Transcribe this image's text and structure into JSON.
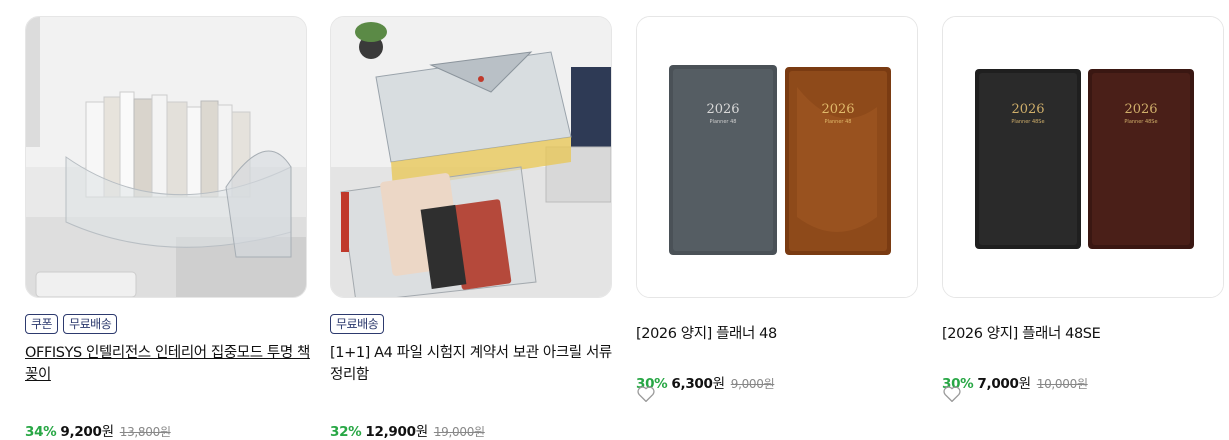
{
  "products": [
    {
      "image_alt": "acrylic bookshelf with books",
      "badges": [
        "쿠폰",
        "무료배송"
      ],
      "title": "OFFISYS 인텔리전스 인테리어 집중모드 투명 책꽂이",
      "discount": "34%",
      "price": "9,200",
      "currency": "원",
      "original_price": "13,800원"
    },
    {
      "image_alt": "acrylic A4 file storage box",
      "badges": [
        "무료배송"
      ],
      "title": "[1+1] A4 파일 시험지 계약서 보관 아크릴 서류 정리함",
      "discount": "32%",
      "price": "12,900",
      "currency": "원",
      "original_price": "19,000원"
    },
    {
      "image_alt": "2026 planner 48 black and brown",
      "badges": [],
      "title": "[2026 양지] 플래너 48",
      "discount": "30%",
      "price": "6,300",
      "currency": "원",
      "original_price": "9,000원",
      "cover_year": "2026",
      "cover_sub": "Planner 48"
    },
    {
      "image_alt": "2026 planner 48SE black and brown",
      "badges": [],
      "title": "[2026 양지] 플래너 48SE",
      "discount": "30%",
      "price": "7,000",
      "currency": "원",
      "original_price": "10,000원",
      "cover_year": "2026",
      "cover_sub": "Planner 48Se"
    }
  ],
  "colors": {
    "badge": "#2d3a6e",
    "discount": "#28a745",
    "heart": "#9a9a9a"
  },
  "icons": {
    "wishlist": "heart-outline-icon"
  }
}
